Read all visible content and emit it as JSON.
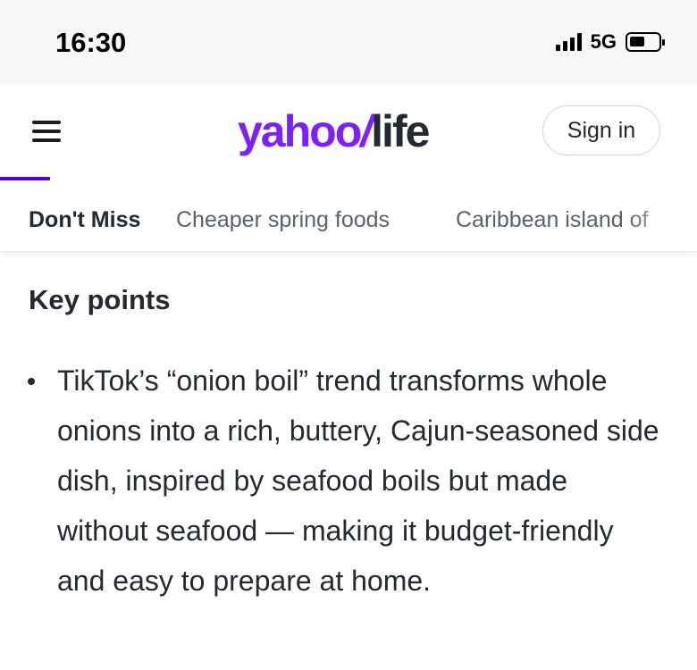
{
  "status_bar": {
    "time": "16:30",
    "network": "5G",
    "battery_level": 0.5
  },
  "header": {
    "logo_yahoo": "yahoo",
    "logo_slash": "/",
    "logo_life": "life",
    "sign_in_label": "Sign in",
    "brand_color": "#7e1fff"
  },
  "subnav": {
    "items": [
      "Don't Miss",
      "Cheaper spring foods",
      "Caribbean island of"
    ],
    "active_index": 0
  },
  "article": {
    "key_points_title": "Key points",
    "bullets": [
      "TikTok’s “onion boil” trend transforms whole onions into a rich, buttery, Cajun-seasoned side dish, inspired by seafood boils but made without seafood — making it budget-friendly and easy to prepare at home."
    ]
  }
}
